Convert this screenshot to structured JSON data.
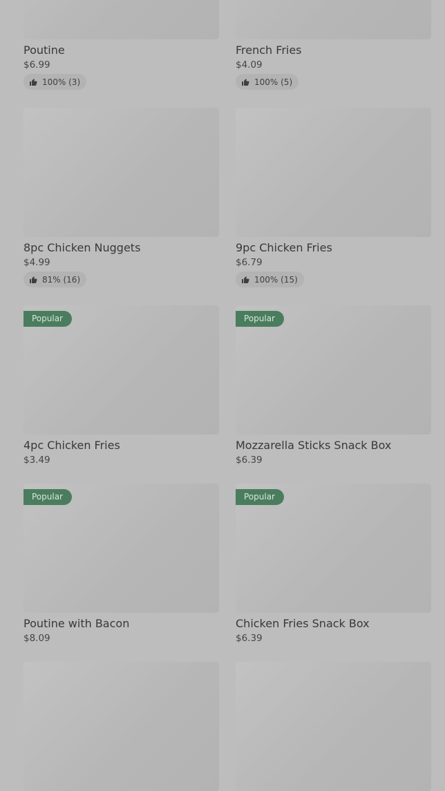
{
  "items": [
    {
      "name": "Poutine",
      "price": "$6.99",
      "rating": "100% (3)",
      "badge": ""
    },
    {
      "name": "French Fries",
      "price": "$4.09",
      "rating": "100% (5)",
      "badge": ""
    },
    {
      "name": "8pc Chicken Nuggets",
      "price": "$4.99",
      "rating": "81% (16)",
      "badge": ""
    },
    {
      "name": "9pc Chicken Fries",
      "price": "$6.79",
      "rating": "100% (15)",
      "badge": ""
    },
    {
      "name": "4pc Chicken Fries",
      "price": "$3.49",
      "rating": "",
      "badge": "Popular"
    },
    {
      "name": "Mozzarella Sticks Snack Box",
      "price": "$6.39",
      "rating": "",
      "badge": "Popular"
    },
    {
      "name": "Poutine with Bacon",
      "price": "$8.09",
      "rating": "",
      "badge": "Popular"
    },
    {
      "name": "Chicken Fries Snack Box",
      "price": "$6.39",
      "rating": "",
      "badge": "Popular"
    },
    {
      "name": "",
      "price": "",
      "rating": "",
      "badge": ""
    },
    {
      "name": "",
      "price": "",
      "rating": "",
      "badge": ""
    }
  ],
  "icons": {
    "rating": "thumbs-up-icon"
  },
  "colors": {
    "badge": "#4a7d5e",
    "rating_chip": "#b3b3b3",
    "overlay": "#bdbdbd"
  }
}
